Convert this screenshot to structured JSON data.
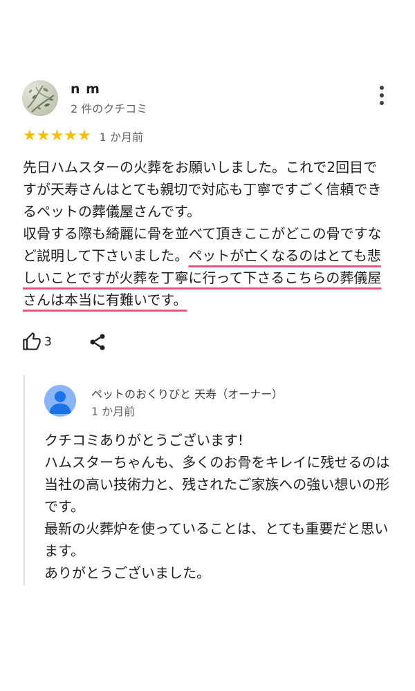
{
  "review": {
    "reviewer_name": "n m",
    "review_count": "2 件のクチコミ",
    "rating": 5,
    "star_char": "★",
    "date": "1 か月前",
    "paragraph1": "先日ハムスターの火葬をお願いしました。これで2回目ですが天寿さんはとても親切で対応も丁寧ですごく信頼できるペットの葬儀屋さんです。",
    "paragraph2_plain": "収骨する際も綺麗に骨を並べて頂きここがどこの骨ですなど説明して下さいました。",
    "paragraph2_highlight": "ペットが亡くなるのはとても悲しいことですが火葬を丁寧に行って下さるこちらの葬儀屋さんは本当に有難いです。",
    "highlight_color": "#e05c7a",
    "star_color": "#fbbc04"
  },
  "actions": {
    "like_count": "3"
  },
  "owner_reply": {
    "name": "ペットのおくりびと 天寿（オーナー）",
    "date": "1 か月前",
    "lines": [
      "クチコミありがとうございます!",
      "ハムスターちゃんも、多くのお骨をキレイに残せるのは当社の高い技術力と、残されたご家族への強い想いの形です。",
      "最新の火葬炉を使っていることは、とても重要だと思います。",
      "ありがとうございました。"
    ],
    "avatar_color": "#8ab4f8"
  },
  "icons": {
    "menu": "more-vert-icon",
    "like": "thumb-up-icon",
    "share": "share-icon",
    "owner_avatar": "person-icon"
  }
}
